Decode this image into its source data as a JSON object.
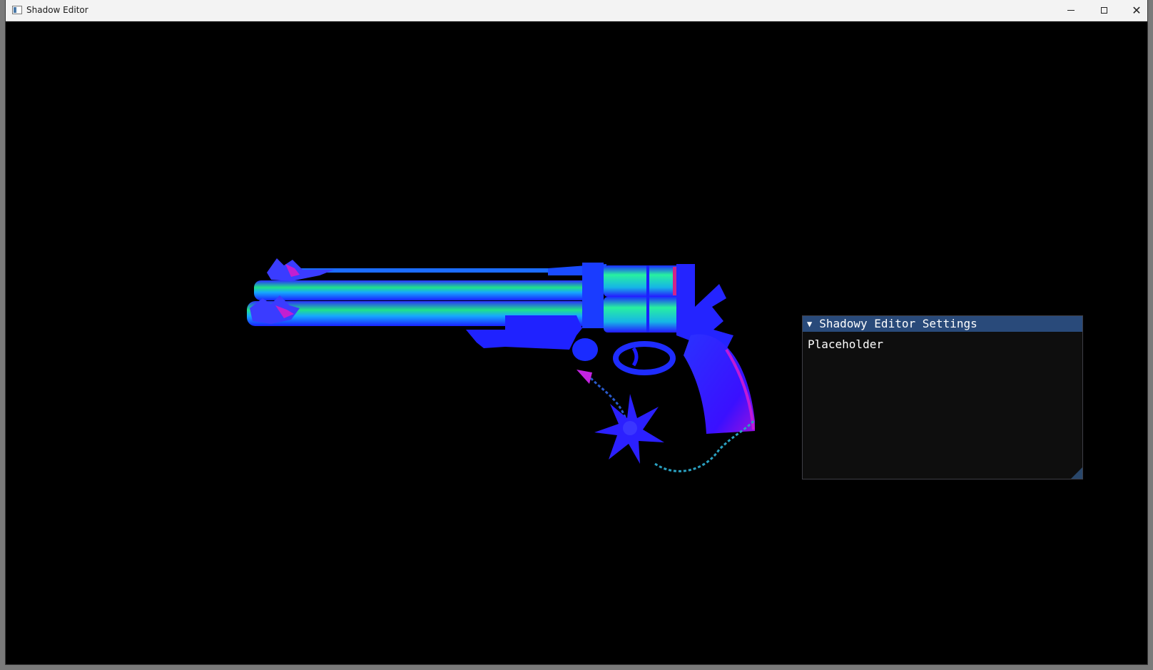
{
  "window": {
    "title": "Shadow Editor",
    "icon": "app-window-icon",
    "controls": {
      "minimize": "minimize-icon",
      "maximize": "maximize-icon",
      "close": "close-icon"
    }
  },
  "viewport": {
    "background": "#000000",
    "model": "revolver-normal-map-render"
  },
  "settings_panel": {
    "title": "Shadowy Editor Settings",
    "collapse_icon": "▼",
    "body_text": "Placeholder",
    "title_color": "#294a7a"
  }
}
